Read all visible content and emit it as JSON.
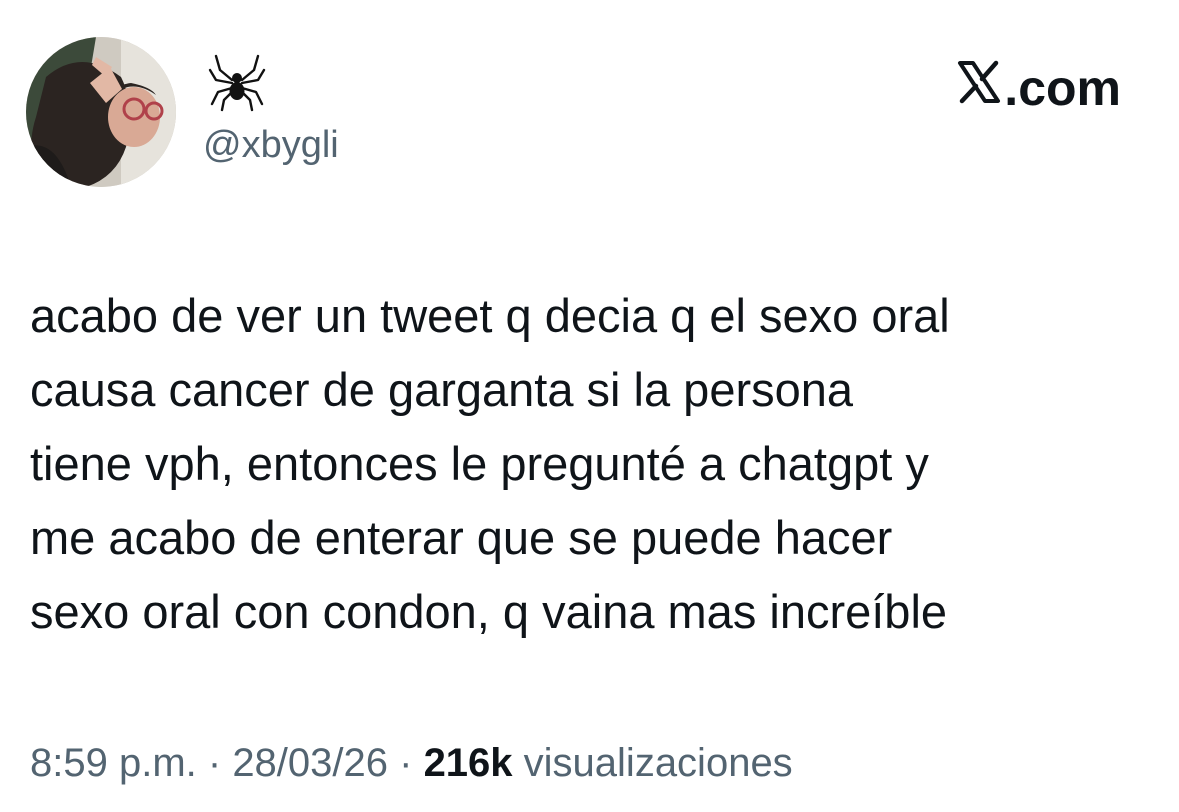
{
  "author": {
    "display_name_icon": "spider-icon",
    "handle": "@xbygli"
  },
  "brand": {
    "logo_icon": "x-logo-icon",
    "suffix": ".com"
  },
  "tweet": {
    "text": "acabo de ver un tweet q decia q el sexo oral\ncausa cancer de garganta si la persona\ntiene vph, entonces le pregunté a chatgpt y\nme acabo de enterar que se puede hacer\nsexo oral con condon, q vaina mas increíble"
  },
  "meta": {
    "time": "8:59 p.m.",
    "separator": " · ",
    "date": "28/03/26",
    "views_count": "216k",
    "views_label": " visualizaciones"
  },
  "colors": {
    "text_primary": "#0f1419",
    "text_secondary": "#536471",
    "background": "#ffffff"
  }
}
